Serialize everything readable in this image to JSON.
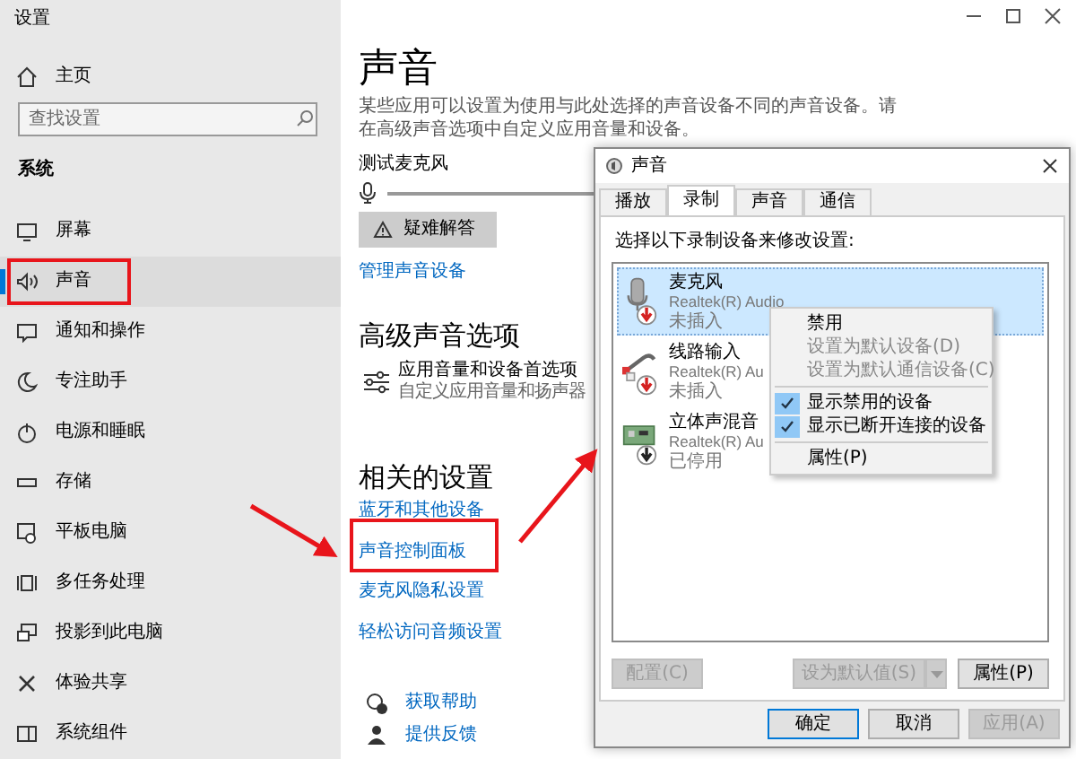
{
  "window": {
    "title": "设置"
  },
  "sidebar": {
    "home": "主页",
    "search": {
      "placeholder": "查找设置"
    },
    "section": "系统",
    "items": [
      {
        "label": "屏幕",
        "selected": false
      },
      {
        "label": "声音",
        "selected": true
      },
      {
        "label": "通知和操作",
        "selected": false
      },
      {
        "label": "专注助手",
        "selected": false
      },
      {
        "label": "电源和睡眠",
        "selected": false
      },
      {
        "label": "存储",
        "selected": false
      },
      {
        "label": "平板电脑",
        "selected": false
      },
      {
        "label": "多任务处理",
        "selected": false
      },
      {
        "label": "投影到此电脑",
        "selected": false
      },
      {
        "label": "体验共享",
        "selected": false
      },
      {
        "label": "系统组件",
        "selected": false
      }
    ]
  },
  "page": {
    "title": "声音",
    "description": "某些应用可以设置为使用与此处选择的声音设备不同的声音设备。请在高级声音选项中自定义应用音量和设备。",
    "mic_test": {
      "label": "测试麦克风",
      "level": 0
    },
    "troubleshoot_button": "疑难解答",
    "manage_link": "管理声音设备",
    "advanced": {
      "heading": "高级声音选项",
      "option": {
        "title": "应用音量和设备首选项",
        "subtitle": "自定义应用音量和扬声器"
      }
    },
    "related": {
      "heading": "相关的设置",
      "links": [
        "蓝牙和其他设备",
        "声音控制面板",
        "麦克风隐私设置",
        "轻松访问音频设置"
      ]
    },
    "help": [
      "获取帮助",
      "提供反馈"
    ]
  },
  "dialog": {
    "title": "声音",
    "tabs": [
      {
        "label": "播放",
        "selected": false
      },
      {
        "label": "录制",
        "selected": true
      },
      {
        "label": "声音",
        "selected": false
      },
      {
        "label": "通信",
        "selected": false
      }
    ],
    "prompt": "选择以下录制设备来修改设置:",
    "devices": [
      {
        "name": "麦克风",
        "driver": "Realtek(R) Audio",
        "status": "未插入",
        "selected": true,
        "disabled": false
      },
      {
        "name": "线路输入",
        "driver": "Realtek(R) Au",
        "status": "未插入",
        "selected": false,
        "disabled": false
      },
      {
        "name": "立体声混音",
        "driver": "Realtek(R) Au",
        "status": "已停用",
        "selected": false,
        "disabled": true
      }
    ],
    "context_menu": [
      {
        "label": "禁用",
        "disabled": false,
        "checked": false,
        "separator_before": false
      },
      {
        "label": "设置为默认设备(D)",
        "disabled": true,
        "checked": false,
        "separator_before": false
      },
      {
        "label": "设置为默认通信设备(C)",
        "disabled": true,
        "checked": false,
        "separator_before": false
      },
      {
        "label": "显示禁用的设备",
        "disabled": false,
        "checked": true,
        "separator_before": true
      },
      {
        "label": "显示已断开连接的设备",
        "disabled": false,
        "checked": true,
        "separator_before": false
      },
      {
        "label": "属性(P)",
        "disabled": false,
        "checked": false,
        "separator_before": true
      }
    ],
    "buttons": [
      {
        "label": "配置(C)",
        "disabled": true,
        "kind": "plain"
      },
      {
        "label": "设为默认值(S)",
        "disabled": true,
        "kind": "split"
      },
      {
        "label": "属性(P)",
        "disabled": false,
        "kind": "plain"
      }
    ],
    "footer_buttons": [
      {
        "label": "确定",
        "disabled": false,
        "default": true
      },
      {
        "label": "取消",
        "disabled": false,
        "default": false
      },
      {
        "label": "应用(A)",
        "disabled": true,
        "default": false
      }
    ]
  }
}
